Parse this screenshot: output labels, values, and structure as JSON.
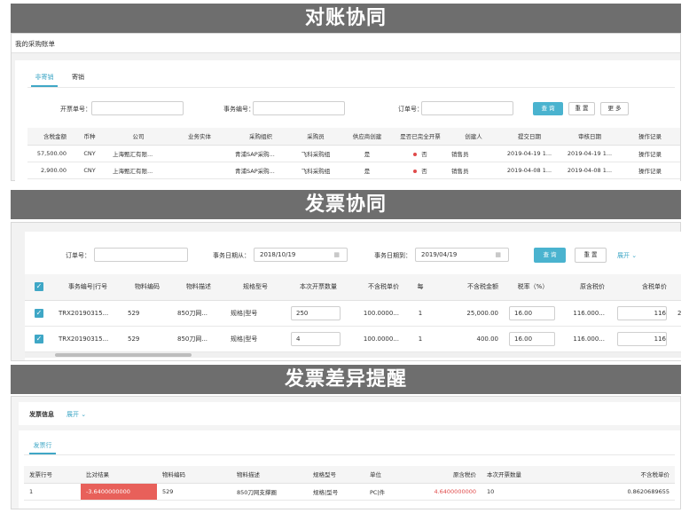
{
  "s1": {
    "banner": "对账协同",
    "title": "我的采购账单",
    "tabs": [
      "非寄销",
      "寄销"
    ],
    "filters": {
      "invoice_no": "开票单号：",
      "business_no": "事务编号：",
      "order_no": "订单号："
    },
    "buttons": {
      "query": "查 询",
      "reset": "重 置",
      "more": "更 多"
    },
    "columns": [
      "含税金额",
      "币种",
      "公司",
      "业务实体",
      "采购组织",
      "采购员",
      "供应商创建",
      "是否已完全开票",
      "创建人",
      "提交日期",
      "审核日期",
      "操作记录"
    ],
    "rows": [
      [
        "57,500.00",
        "CNY",
        "上海甄汇有限...",
        "",
        "青浦SAP采购...",
        "飞科采购组",
        "是",
        "否",
        "销售员",
        "2019-04-19 1...",
        "2019-04-19 1...",
        "操作记录"
      ],
      [
        "2,900.00",
        "CNY",
        "上海甄汇有限...",
        "",
        "青浦SAP采购...",
        "飞科采购组",
        "是",
        "否",
        "销售员",
        "2019-04-08 1...",
        "2019-04-08 1...",
        "操作记录"
      ]
    ]
  },
  "s2": {
    "banner": "发票协同",
    "filters": {
      "order_no": "订单号：",
      "date_from_label": "事务日期从：",
      "date_from": "2018/10/19",
      "date_to_label": "事务日期到：",
      "date_to": "2019/04/19"
    },
    "buttons": {
      "query": "查 询",
      "reset": "重 置",
      "expand": "展开"
    },
    "columns": [
      "事务编号|行号",
      "物料编码",
      "物料描述",
      "规格型号",
      "本次开票数量",
      "不含税单价",
      "每",
      "不含税金额",
      "税率（%）",
      "原含税价",
      "含税单价",
      "⼝"
    ],
    "rows": [
      [
        "TRX20190315...",
        "529",
        "850刀网...",
        "规格|型号",
        "250",
        "100.0000...",
        "1",
        "25,000.00",
        "16.00",
        "116.000...",
        "116",
        "2("
      ],
      [
        "TRX20190315...",
        "529",
        "850刀网...",
        "规格|型号",
        "4",
        "100.0000...",
        "1",
        "400.00",
        "16.00",
        "116.000...",
        "116",
        ""
      ]
    ]
  },
  "s3": {
    "banner": "发票差异提醒",
    "info_label": "发票信息",
    "expand": "展开",
    "tab": "发票行",
    "columns": [
      "发票行号",
      "比对结果",
      "物料编码",
      "物料描述",
      "规格型号",
      "单位",
      "原含税价",
      "本次开票数量",
      "不含税单价"
    ],
    "rows": [
      [
        "1",
        "-3.6400000000",
        "529",
        "850刀网支撑圈",
        "规格|型号",
        "PC|件",
        "4.6400000000",
        "10",
        "0.8620689655"
      ]
    ]
  },
  "colors": {
    "accent": "#3fa7c6",
    "banner": "#6e6e6e",
    "danger": "#e8605a"
  }
}
